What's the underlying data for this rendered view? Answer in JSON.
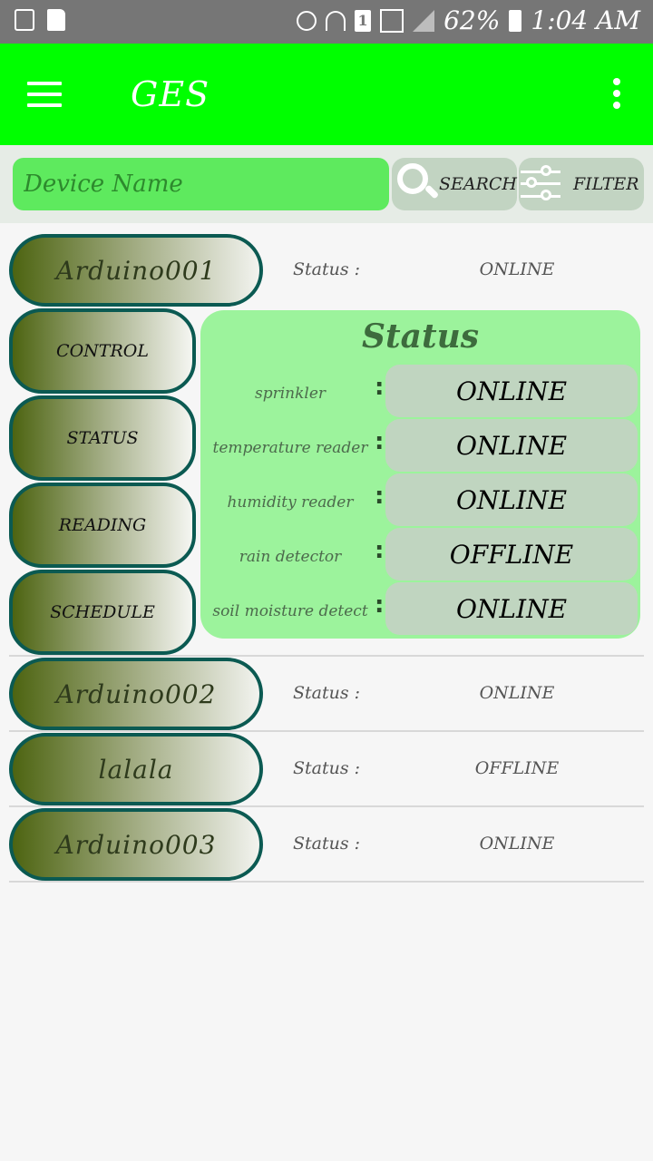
{
  "status_bar": {
    "battery": "62%",
    "time": "1:04 AM",
    "sim_slot": "1"
  },
  "app_bar": {
    "title": "GES"
  },
  "search": {
    "placeholder": "Device Name",
    "search_label": "SEARCH",
    "filter_label": "FILTER"
  },
  "devices": [
    {
      "name": "Arduino001",
      "status_label": "Status :",
      "status": "ONLINE"
    },
    {
      "name": "Arduino002",
      "status_label": "Status :",
      "status": "ONLINE"
    },
    {
      "name": "lalala",
      "status_label": "Status :",
      "status": "OFFLINE"
    },
    {
      "name": "Arduino003",
      "status_label": "Status :",
      "status": "ONLINE"
    }
  ],
  "submenu": {
    "control": "CONTROL",
    "status": "STATUS",
    "reading": "READING",
    "schedule": "SCHEDULE"
  },
  "status_panel": {
    "title": "Status",
    "rows": [
      {
        "label": "sprinkler",
        "colon": ":",
        "value": "ONLINE"
      },
      {
        "label": "temperature reader",
        "colon": ":",
        "value": "ONLINE"
      },
      {
        "label": "humidity reader",
        "colon": ":",
        "value": "ONLINE"
      },
      {
        "label": "rain detector",
        "colon": ":",
        "value": "OFFLINE"
      },
      {
        "label": "soil moisture detect",
        "colon": ":",
        "value": "ONLINE"
      }
    ]
  }
}
